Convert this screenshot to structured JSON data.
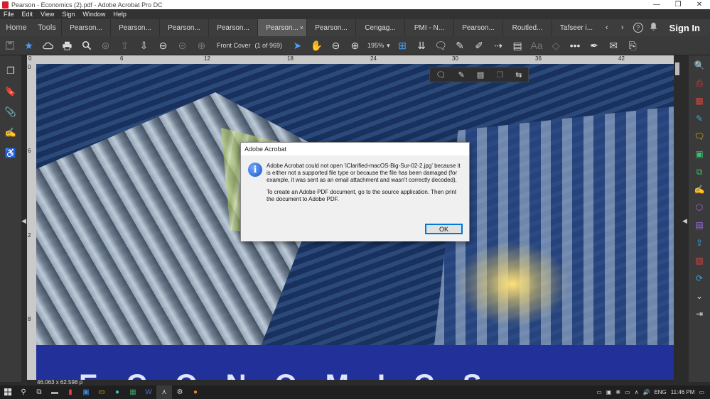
{
  "window": {
    "title": "Pearson - Economics (2).pdf - Adobe Acrobat Pro DC",
    "minimize": "—",
    "maximize": "❐",
    "close": "✕"
  },
  "menu": [
    "File",
    "Edit",
    "View",
    "Sign",
    "Window",
    "Help"
  ],
  "tabs": {
    "home": "Home",
    "tools": "Tools",
    "documents": [
      "Pearson...",
      "Pearson...",
      "Pearson...",
      "Pearson...",
      "Pearson...",
      "Pearson...",
      "Cengag...",
      "PMI - N...",
      "Pearson...",
      "Routled...",
      "Tafseer i..."
    ],
    "active_index": 4,
    "close_glyph": "×",
    "prev": "‹",
    "next": "›",
    "help_icon": "?",
    "signin": "Sign In"
  },
  "toolbar": {
    "page_label": "Front Cover",
    "page_count": "(1 of 969)",
    "zoom": "195%",
    "zoom_caret": "▾"
  },
  "ruler": {
    "top_ticks": [
      "0",
      "6",
      "12",
      "18",
      "24",
      "30",
      "36",
      "42"
    ],
    "left_ticks": [
      "0",
      "6",
      "2",
      "8"
    ]
  },
  "cover": {
    "letters": "ECONOMICS"
  },
  "status": {
    "dimensions": "46.063 x 62.598 p"
  },
  "dialog": {
    "title": "Adobe Acrobat",
    "message": "Adobe Acrobat could not open 'iClarified-macOS-Big-Sur-02-2.jpg' because it is either not a supported file type or because the file has been damaged (for example, it was sent as an email attachment and wasn't correctly decoded).",
    "hint": "To create an Adobe PDF document, go to the source application. Then print the document to Adobe PDF.",
    "ok": "OK",
    "info_glyph": "i"
  },
  "tray": {
    "lang": "ENG",
    "time": "11:46 PM"
  },
  "colors": {
    "dialog_focus": "#0078d7",
    "active_tab": "#5a5a5a",
    "accent_blue": "#4aa0ff"
  }
}
